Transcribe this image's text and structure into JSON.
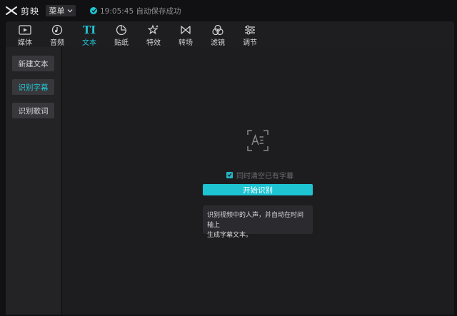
{
  "app": {
    "name": "剪映"
  },
  "topbar": {
    "menu_label": "菜单",
    "save_status": "19:05:45 自动保存成功"
  },
  "toolbar": {
    "tabs": [
      {
        "label": "媒体",
        "icon": "media-icon"
      },
      {
        "label": "音频",
        "icon": "audio-icon"
      },
      {
        "label": "文本",
        "icon": "text-icon",
        "active": true
      },
      {
        "label": "贴纸",
        "icon": "sticker-icon"
      },
      {
        "label": "特效",
        "icon": "effects-icon"
      },
      {
        "label": "转场",
        "icon": "transition-icon"
      },
      {
        "label": "滤镜",
        "icon": "filter-icon"
      },
      {
        "label": "调节",
        "icon": "adjust-icon"
      }
    ]
  },
  "sidebar": {
    "items": [
      {
        "label": "新建文本"
      },
      {
        "label": "识别字幕",
        "active": true
      },
      {
        "label": "识别歌词"
      }
    ]
  },
  "main": {
    "clear_checkbox_label": "同时清空已有字幕",
    "clear_checked": true,
    "start_button": "开始识别",
    "description": "识别视频中的人声，并自动在时间轴上\n生成字幕文本。"
  },
  "colors": {
    "accent": "#1ec4d2",
    "background": "#111113",
    "panel": "#1d1d20"
  }
}
